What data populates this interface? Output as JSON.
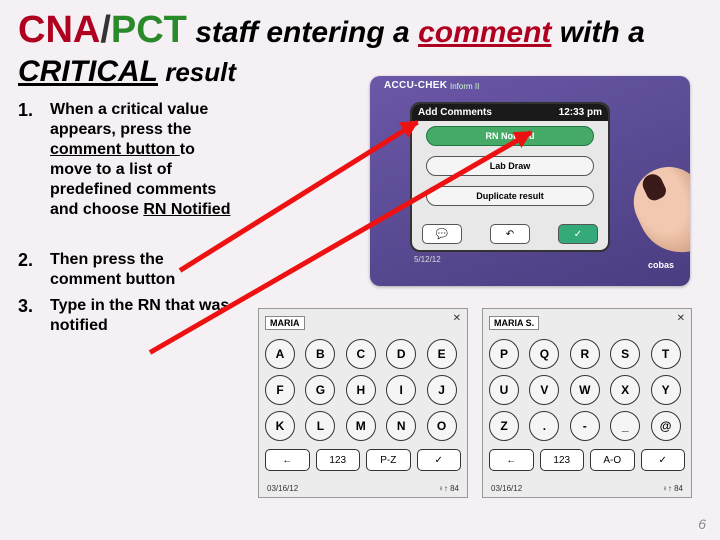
{
  "title": {
    "cna": "CNA",
    "slash": "/",
    "pct": "PCT",
    "mid1": " staff entering a ",
    "comment": "comment",
    "mid2": " with a ",
    "critical": "CRITICAL",
    "result": " result"
  },
  "steps": [
    {
      "num": "1.",
      "pre": "When a critical value appears, press the ",
      "u1": "comment button ",
      "mid": "to move to a list of predefined comments and choose ",
      "u2": "RN Notified"
    },
    {
      "num": "2.",
      "text": "Then press the comment button"
    },
    {
      "num": "3.",
      "text": "Type in the RN that was notified"
    }
  ],
  "device": {
    "brand": "ACCU-CHEK",
    "brand_sub": "Inform II",
    "screen_title": "Add Comments",
    "screen_time": "12:33 pm",
    "options": [
      "RN Notified",
      "Lab Draw",
      "Duplicate result"
    ],
    "footer_icons": {
      "speech": "💬",
      "back": "↶",
      "ok": "✓"
    },
    "date": "5/12/12",
    "cobas": "cobas"
  },
  "pad_left": {
    "label": "MARIA",
    "keys": [
      "A",
      "B",
      "C",
      "D",
      "E",
      "F",
      "G",
      "H",
      "I",
      "J",
      "K",
      "L",
      "M",
      "N",
      "O"
    ],
    "bottom": [
      "←",
      "123",
      "P-Z",
      "✓"
    ],
    "date": "03/16/12",
    "sig": "♀↑ 84"
  },
  "pad_right": {
    "label": "MARIA S.",
    "keys": [
      "P",
      "Q",
      "R",
      "S",
      "T",
      "U",
      "V",
      "W",
      "X",
      "Y",
      "Z",
      ".",
      "-",
      "_",
      "@"
    ],
    "bottom": [
      "←",
      "123",
      "A-O",
      "✓"
    ],
    "date": "03/16/12",
    "sig": "♀↑ 84"
  },
  "page_number": "6"
}
